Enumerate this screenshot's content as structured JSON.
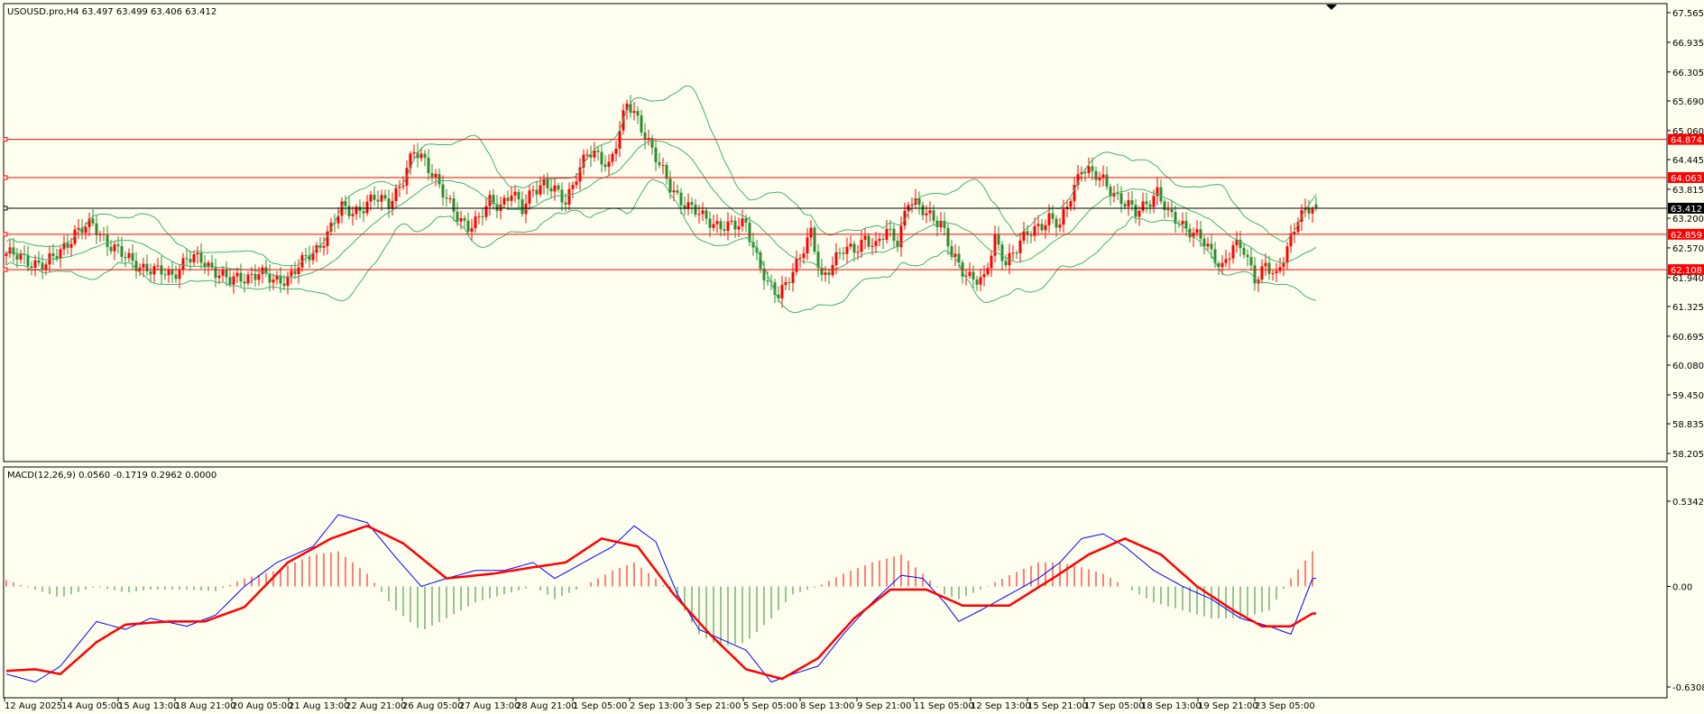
{
  "chart_data": [
    {
      "type": "candlestick",
      "header": "USOUSD.pro,H4  63.497 63.499 63.406 63.412",
      "symbol": "USOUSD.pro",
      "timeframe": "H4",
      "ohlc_last": [
        63.497,
        63.499,
        63.406,
        63.412
      ],
      "ylim": [
        58.205,
        67.565
      ],
      "y_ticks": [
        "67.565",
        "66.935",
        "66.305",
        "65.690",
        "65.060",
        "64.445",
        "63.815",
        "63.200",
        "62.570",
        "61.940",
        "61.325",
        "60.695",
        "60.080",
        "59.450",
        "58.835",
        "58.205"
      ],
      "x_ticks": [
        "12 Aug 2025",
        "14 Aug 05:00",
        "15 Aug 13:00",
        "18 Aug 21:00",
        "20 Aug 05:00",
        "21 Aug 13:00",
        "22 Aug 21:00",
        "26 Aug 05:00",
        "27 Aug 13:00",
        "28 Aug 21:00",
        "1 Sep 05:00",
        "2 Sep 13:00",
        "3 Sep 21:00",
        "5 Sep 05:00",
        "8 Sep 13:00",
        "9 Sep 21:00",
        "11 Sep 05:00",
        "12 Sep 13:00",
        "15 Sep 21:00",
        "17 Sep 05:00",
        "18 Sep 13:00",
        "19 Sep 21:00",
        "23 Sep 05:00"
      ],
      "horizontal_levels": [
        {
          "label": "64.874",
          "value": 64.874,
          "color": "#ff0000"
        },
        {
          "label": "64.063",
          "value": 64.063,
          "color": "#ff0000"
        },
        {
          "label": "62.859",
          "value": 62.859,
          "color": "#ff0000"
        },
        {
          "label": "62.108",
          "value": 62.108,
          "color": "#ff0000"
        }
      ],
      "current_price": {
        "label": "63.412",
        "value": 63.412,
        "color": "#000000"
      },
      "colors": {
        "up": "#ff0000",
        "down": "#2e8b2e",
        "bands": "#3cb371",
        "background": "#fffff0"
      },
      "bollinger_bands": true,
      "close_path": [
        [
          0,
          62.45
        ],
        [
          6,
          62.3
        ],
        [
          11,
          62.2
        ],
        [
          15,
          62.5
        ],
        [
          19,
          62.9
        ],
        [
          24,
          63.05
        ],
        [
          28,
          62.7
        ],
        [
          33,
          62.35
        ],
        [
          37,
          62.2
        ],
        [
          42,
          62.05
        ],
        [
          46,
          62.0
        ],
        [
          50,
          62.35
        ],
        [
          54,
          62.3
        ],
        [
          58,
          62.1
        ],
        [
          62,
          61.85
        ],
        [
          66,
          61.95
        ],
        [
          70,
          62.05
        ],
        [
          74,
          61.85
        ],
        [
          78,
          61.95
        ],
        [
          82,
          62.25
        ],
        [
          86,
          62.55
        ],
        [
          90,
          63.0
        ],
        [
          93,
          63.4
        ],
        [
          96,
          63.35
        ],
        [
          99,
          63.45
        ],
        [
          102,
          63.6
        ],
        [
          106,
          63.55
        ],
        [
          110,
          64.0
        ],
        [
          113,
          64.6
        ],
        [
          116,
          64.45
        ],
        [
          119,
          64.05
        ],
        [
          122,
          63.55
        ],
        [
          125,
          63.25
        ],
        [
          128,
          63.05
        ],
        [
          131,
          63.15
        ],
        [
          134,
          63.55
        ],
        [
          137,
          63.5
        ],
        [
          140,
          63.75
        ],
        [
          143,
          63.35
        ],
        [
          146,
          63.85
        ],
        [
          149,
          63.95
        ],
        [
          152,
          63.75
        ],
        [
          155,
          63.55
        ],
        [
          158,
          64.15
        ],
        [
          161,
          64.55
        ],
        [
          164,
          64.5
        ],
        [
          167,
          64.35
        ],
        [
          170,
          65.05
        ],
        [
          172,
          65.6
        ],
        [
          175,
          65.3
        ],
        [
          178,
          64.85
        ],
        [
          181,
          64.3
        ],
        [
          184,
          63.85
        ],
        [
          187,
          63.6
        ],
        [
          190,
          63.4
        ],
        [
          193,
          63.2
        ],
        [
          196,
          63.1
        ],
        [
          199,
          63.05
        ],
        [
          202,
          63.0
        ],
        [
          205,
          63.1
        ],
        [
          208,
          62.4
        ],
        [
          211,
          61.75
        ],
        [
          214,
          61.55
        ],
        [
          217,
          62.0
        ],
        [
          220,
          62.35
        ],
        [
          223,
          62.85
        ],
        [
          226,
          61.95
        ],
        [
          229,
          62.25
        ],
        [
          232,
          62.5
        ],
        [
          235,
          62.55
        ],
        [
          238,
          62.8
        ],
        [
          241,
          62.55
        ],
        [
          244,
          62.95
        ],
        [
          247,
          62.75
        ],
        [
          250,
          63.55
        ],
        [
          253,
          63.4
        ],
        [
          256,
          63.3
        ],
        [
          259,
          63.1
        ],
        [
          262,
          62.4
        ],
        [
          265,
          62.1
        ],
        [
          268,
          61.95
        ],
        [
          271,
          61.85
        ],
        [
          274,
          62.75
        ],
        [
          277,
          62.3
        ],
        [
          280,
          62.55
        ],
        [
          283,
          62.85
        ],
        [
          286,
          63.05
        ],
        [
          289,
          63.2
        ],
        [
          292,
          63.0
        ],
        [
          295,
          63.7
        ],
        [
          298,
          64.3
        ],
        [
          301,
          64.1
        ],
        [
          304,
          64.0
        ],
        [
          307,
          63.75
        ],
        [
          310,
          63.5
        ],
        [
          313,
          63.3
        ],
        [
          316,
          63.55
        ],
        [
          319,
          63.75
        ],
        [
          322,
          63.25
        ],
        [
          325,
          63.15
        ],
        [
          328,
          62.95
        ],
        [
          331,
          62.75
        ],
        [
          334,
          62.45
        ],
        [
          337,
          62.2
        ],
        [
          340,
          62.6
        ],
        [
          343,
          62.5
        ],
        [
          346,
          61.95
        ],
        [
          349,
          62.2
        ],
        [
          352,
          61.9
        ],
        [
          355,
          62.6
        ],
        [
          358,
          63.25
        ],
        [
          361,
          63.35
        ],
        [
          363,
          63.41
        ]
      ]
    },
    {
      "type": "macd",
      "header": "MACD(12,26,9) 0.0560 -0.1719 0.2962 0.0000",
      "params": "MACD(12,26,9)",
      "values": [
        0.056,
        -0.1719,
        0.2962,
        0.0
      ],
      "ylim": [
        -0.6308,
        0.5342
      ],
      "y_ticks": [
        "0.5342",
        "0.00",
        "-0.6308"
      ],
      "colors": {
        "histogram_up": "#ff0000",
        "histogram_down": "#2e8b2e",
        "macd_line": "#0000ff",
        "signal_line": "#ff0000"
      },
      "macd_line": [
        [
          0,
          -0.55
        ],
        [
          8,
          -0.6
        ],
        [
          15,
          -0.5
        ],
        [
          25,
          -0.22
        ],
        [
          33,
          -0.27
        ],
        [
          40,
          -0.2
        ],
        [
          50,
          -0.25
        ],
        [
          58,
          -0.18
        ],
        [
          66,
          0.0
        ],
        [
          75,
          0.15
        ],
        [
          85,
          0.25
        ],
        [
          92,
          0.45
        ],
        [
          100,
          0.4
        ],
        [
          108,
          0.18
        ],
        [
          115,
          0.0
        ],
        [
          122,
          0.05
        ],
        [
          130,
          0.1
        ],
        [
          138,
          0.1
        ],
        [
          146,
          0.15
        ],
        [
          152,
          0.05
        ],
        [
          160,
          0.15
        ],
        [
          168,
          0.25
        ],
        [
          174,
          0.38
        ],
        [
          180,
          0.28
        ],
        [
          186,
          -0.05
        ],
        [
          192,
          -0.27
        ],
        [
          198,
          -0.33
        ],
        [
          205,
          -0.4
        ],
        [
          212,
          -0.6
        ],
        [
          218,
          -0.55
        ],
        [
          225,
          -0.5
        ],
        [
          232,
          -0.3
        ],
        [
          240,
          -0.1
        ],
        [
          248,
          0.07
        ],
        [
          254,
          0.05
        ],
        [
          260,
          -0.1
        ],
        [
          264,
          -0.22
        ],
        [
          270,
          -0.15
        ],
        [
          278,
          -0.05
        ],
        [
          286,
          0.05
        ],
        [
          292,
          0.15
        ],
        [
          298,
          0.3
        ],
        [
          304,
          0.33
        ],
        [
          310,
          0.25
        ],
        [
          318,
          0.1
        ],
        [
          326,
          0.0
        ],
        [
          334,
          -0.08
        ],
        [
          342,
          -0.2
        ],
        [
          350,
          -0.25
        ],
        [
          356,
          -0.3
        ],
        [
          362,
          0.05
        ]
      ],
      "signal_line": [
        [
          0,
          -0.53
        ],
        [
          8,
          -0.52
        ],
        [
          15,
          -0.55
        ],
        [
          25,
          -0.35
        ],
        [
          33,
          -0.24
        ],
        [
          45,
          -0.22
        ],
        [
          55,
          -0.22
        ],
        [
          66,
          -0.13
        ],
        [
          78,
          0.15
        ],
        [
          90,
          0.3
        ],
        [
          100,
          0.38
        ],
        [
          110,
          0.27
        ],
        [
          122,
          0.05
        ],
        [
          135,
          0.08
        ],
        [
          146,
          0.12
        ],
        [
          155,
          0.15
        ],
        [
          165,
          0.3
        ],
        [
          175,
          0.25
        ],
        [
          185,
          -0.05
        ],
        [
          195,
          -0.3
        ],
        [
          205,
          -0.52
        ],
        [
          215,
          -0.58
        ],
        [
          225,
          -0.45
        ],
        [
          235,
          -0.2
        ],
        [
          245,
          -0.02
        ],
        [
          255,
          -0.02
        ],
        [
          265,
          -0.12
        ],
        [
          278,
          -0.12
        ],
        [
          290,
          0.05
        ],
        [
          300,
          0.2
        ],
        [
          310,
          0.3
        ],
        [
          320,
          0.2
        ],
        [
          330,
          0.0
        ],
        [
          340,
          -0.15
        ],
        [
          348,
          -0.25
        ],
        [
          356,
          -0.25
        ],
        [
          362,
          -0.17
        ]
      ],
      "histogram": [
        [
          0,
          0.04
        ],
        [
          8,
          -0.02
        ],
        [
          15,
          -0.07
        ],
        [
          25,
          0.0
        ],
        [
          33,
          -0.04
        ],
        [
          40,
          -0.02
        ],
        [
          50,
          -0.02
        ],
        [
          58,
          -0.03
        ],
        [
          66,
          0.05
        ],
        [
          75,
          0.1
        ],
        [
          85,
          0.2
        ],
        [
          92,
          0.22
        ],
        [
          100,
          0.08
        ],
        [
          108,
          -0.15
        ],
        [
          115,
          -0.28
        ],
        [
          122,
          -0.2
        ],
        [
          130,
          -0.1
        ],
        [
          138,
          -0.05
        ],
        [
          146,
          0.0
        ],
        [
          152,
          -0.08
        ],
        [
          160,
          0.0
        ],
        [
          168,
          0.1
        ],
        [
          174,
          0.15
        ],
        [
          180,
          0.05
        ],
        [
          186,
          -0.08
        ],
        [
          192,
          -0.3
        ],
        [
          198,
          -0.38
        ],
        [
          205,
          -0.35
        ],
        [
          212,
          -0.2
        ],
        [
          218,
          -0.05
        ],
        [
          225,
          0.0
        ],
        [
          232,
          0.08
        ],
        [
          240,
          0.15
        ],
        [
          248,
          0.2
        ],
        [
          254,
          0.08
        ],
        [
          260,
          -0.05
        ],
        [
          264,
          -0.08
        ],
        [
          270,
          -0.02
        ],
        [
          278,
          0.07
        ],
        [
          286,
          0.15
        ],
        [
          292,
          0.15
        ],
        [
          298,
          0.12
        ],
        [
          304,
          0.08
        ],
        [
          310,
          0.0
        ],
        [
          318,
          -0.1
        ],
        [
          326,
          -0.15
        ],
        [
          334,
          -0.2
        ],
        [
          342,
          -0.2
        ],
        [
          350,
          -0.15
        ],
        [
          356,
          0.05
        ],
        [
          362,
          0.22
        ]
      ]
    }
  ]
}
